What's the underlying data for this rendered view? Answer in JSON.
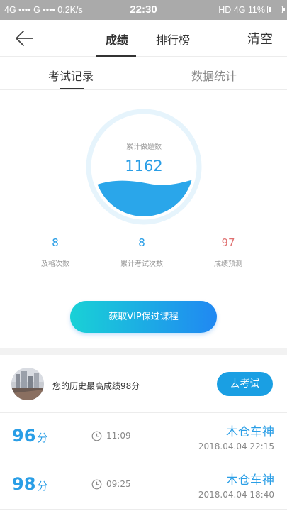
{
  "status_bar": {
    "left_text": "4G •••• G •••• 0.2K/s",
    "time": "22:30",
    "right_text": "HD 4G 11%",
    "battery_percent": 11
  },
  "nav": {
    "tabs": [
      {
        "label": "成绩"
      },
      {
        "label": "排行榜"
      }
    ],
    "active_tab": "成绩",
    "clear_label": "清空",
    "back_icon": "arrow-left-icon"
  },
  "sub_tabs": {
    "tabs": [
      {
        "label": "考试记录"
      },
      {
        "label": "数据统计"
      }
    ],
    "active_tab": "考试记录"
  },
  "gauge": {
    "label": "累计做题数",
    "value": "1162",
    "fill_color": "#2aa6ea",
    "ring_color": "#e6f4fc"
  },
  "stats": [
    {
      "value": "8",
      "label": "及格次数"
    },
    {
      "value": "8",
      "label": "累计考试次数"
    },
    {
      "value": "97",
      "label": "成绩预测"
    }
  ],
  "vip_button": {
    "label": "获取VIP保过课程"
  },
  "best": {
    "text": "您的历史最高成绩98分",
    "button_label": "去考试"
  },
  "records": [
    {
      "score": "96",
      "unit": "分",
      "duration": "11:09",
      "name": "木仓车神",
      "datetime": "2018.04.04  22:15"
    },
    {
      "score": "98",
      "unit": "分",
      "duration": "09:25",
      "name": "木仓车神",
      "datetime": "2018.04.04  18:40"
    }
  ],
  "colors": {
    "accent": "#2a9ee6",
    "predict": "#e07070",
    "status_bar": "#aaaaaa"
  }
}
